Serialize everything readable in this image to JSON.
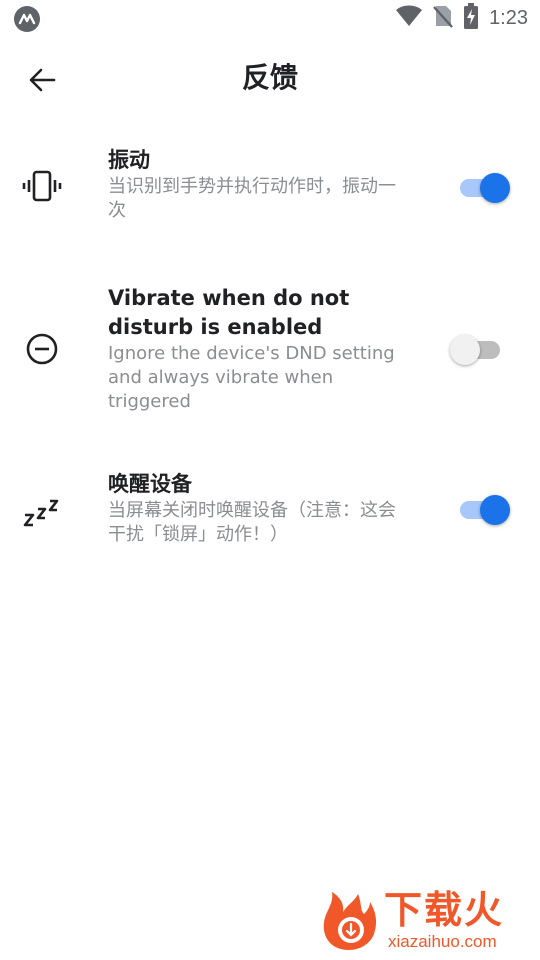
{
  "status_bar": {
    "time": "1:23"
  },
  "app_bar": {
    "title": "反馈"
  },
  "settings": [
    {
      "icon": "vibration-icon",
      "title": "振动",
      "summary": "当识别到手势并执行动作时，振动一次",
      "enabled": true
    },
    {
      "icon": "do-not-disturb-icon",
      "title": "Vibrate when do not disturb is enabled",
      "summary": "Ignore the device's DND setting and always vibrate when triggered",
      "enabled": false
    },
    {
      "icon": "sleep-zzz-icon",
      "title": "唤醒设备",
      "summary": "当屏幕关闭时唤醒设备（注意：这会干扰「锁屏」动作！）",
      "enabled": true
    }
  ],
  "watermark": {
    "brand": "下载火",
    "domain": "xiazaihuo.com"
  },
  "colors": {
    "accent": "#1a73e8",
    "accent_track": "#a8c7fa",
    "title_text": "#202124",
    "summary_text": "#8a8d91",
    "watermark": "#f0582a"
  }
}
